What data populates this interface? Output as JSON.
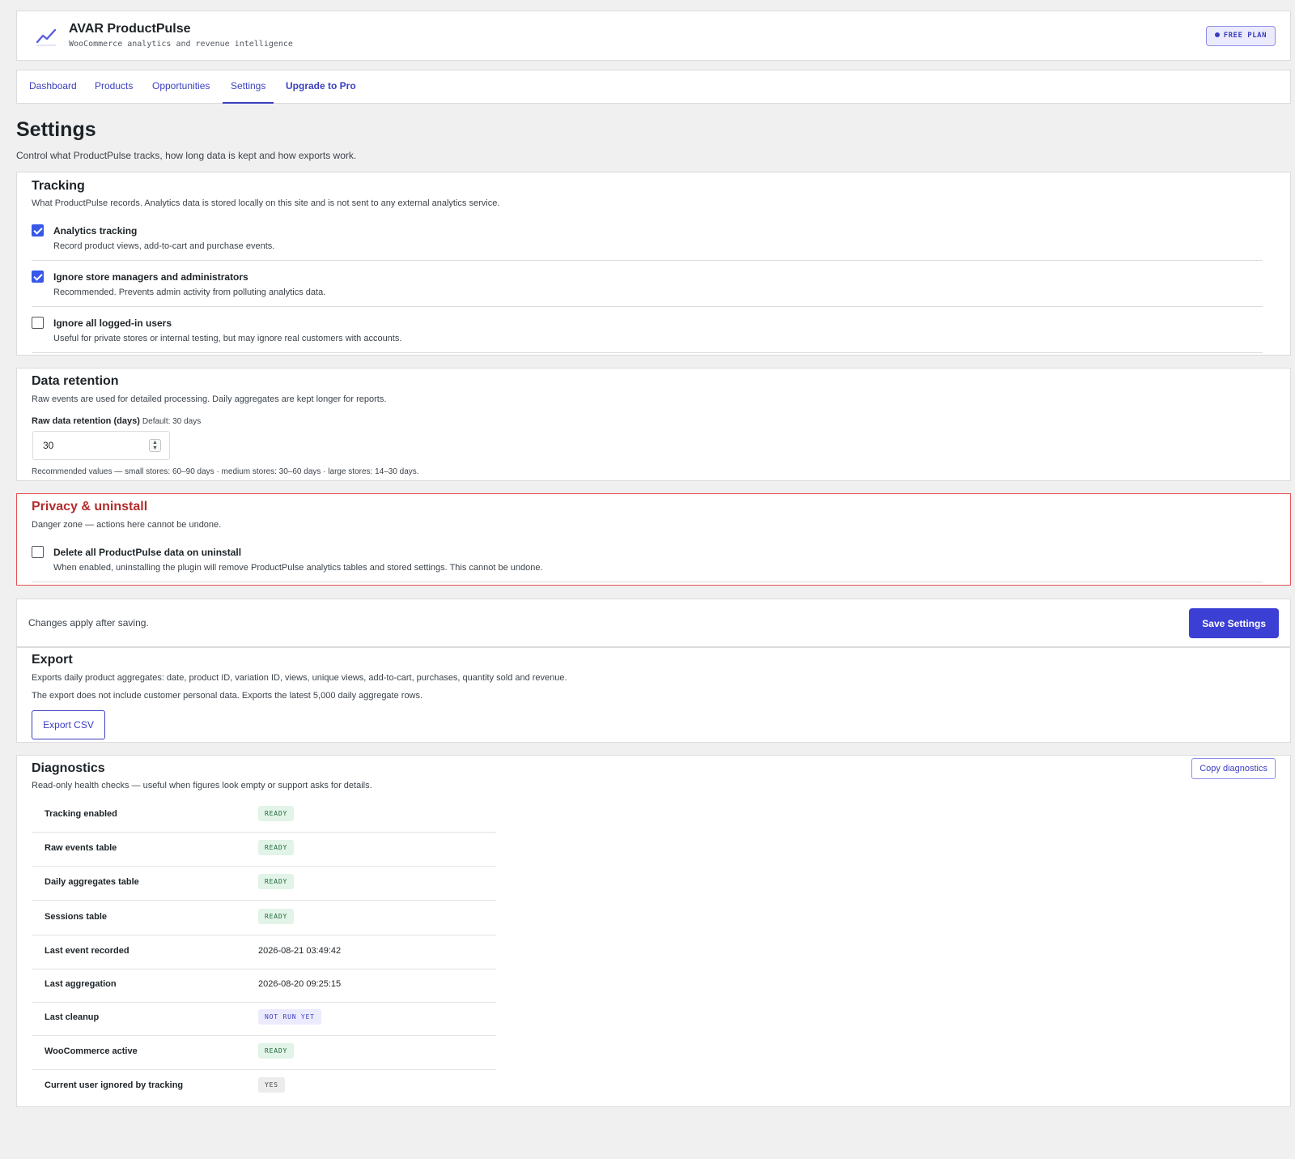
{
  "header": {
    "title": "AVAR ProductPulse",
    "subtitle": "WooCommerce analytics and revenue intelligence",
    "plan_badge": "FREE PLAN",
    "logo_icon": "trend-line-icon"
  },
  "tabs": [
    {
      "label": "Dashboard",
      "active": false
    },
    {
      "label": "Products",
      "active": false
    },
    {
      "label": "Opportunities",
      "active": false
    },
    {
      "label": "Settings",
      "active": true
    },
    {
      "label": "Upgrade to Pro",
      "active": false
    }
  ],
  "page": {
    "title": "Settings",
    "description": "Control what ProductPulse tracks, how long data is kept and how exports work."
  },
  "tracking": {
    "title": "Tracking",
    "description": "What ProductPulse records. Analytics data is stored locally on this site and is not sent to any external analytics service.",
    "options": [
      {
        "label": "Analytics tracking",
        "hint": "Record product views, add-to-cart and purchase events.",
        "checked": true
      },
      {
        "label": "Ignore store managers and administrators",
        "hint": "Recommended. Prevents admin activity from polluting analytics data.",
        "checked": true
      },
      {
        "label": "Ignore all logged-in users",
        "hint": "Useful for private stores or internal testing, but may ignore real customers with accounts.",
        "checked": false
      }
    ]
  },
  "retention": {
    "title": "Data retention",
    "description": "Raw events are used for detailed processing. Daily aggregates are kept longer for reports.",
    "field_label": "Raw data retention (days)",
    "field_default": "Default: 30 days",
    "field_value": "30",
    "recommendation": "Recommended values — small stores: 60–90 days · medium stores: 30–60 days · large stores: 14–30 days."
  },
  "privacy": {
    "title": "Privacy & uninstall",
    "description": "Danger zone — actions here cannot be undone.",
    "option_label": "Delete all ProductPulse data on uninstall",
    "option_hint": "When enabled, uninstalling the plugin will remove ProductPulse analytics tables and stored settings. This cannot be undone.",
    "checked": false
  },
  "savebar": {
    "text": "Changes apply after saving.",
    "button": "Save Settings"
  },
  "export": {
    "title": "Export",
    "line1": "Exports daily product aggregates: date, product ID, variation ID, views, unique views, add-to-cart, purchases, quantity sold and revenue.",
    "line2": "The export does not include customer personal data. Exports the latest 5,000 daily aggregate rows.",
    "button": "Export CSV"
  },
  "diagnostics": {
    "title": "Diagnostics",
    "description": "Read-only health checks — useful when figures look empty or support asks for details.",
    "copy_button": "Copy diagnostics",
    "rows": [
      {
        "key": "Tracking enabled",
        "value": "READY",
        "type": "ready"
      },
      {
        "key": "Raw events table",
        "value": "READY",
        "type": "ready"
      },
      {
        "key": "Daily aggregates table",
        "value": "READY",
        "type": "ready"
      },
      {
        "key": "Sessions table",
        "value": "READY",
        "type": "ready"
      },
      {
        "key": "Last event recorded",
        "value": "2026-08-21 03:49:42",
        "type": "text"
      },
      {
        "key": "Last aggregation",
        "value": "2026-08-20 09:25:15",
        "type": "text"
      },
      {
        "key": "Last cleanup",
        "value": "NOT RUN YET",
        "type": "notrun"
      },
      {
        "key": "WooCommerce active",
        "value": "READY",
        "type": "ready"
      },
      {
        "key": "Current user ignored by tracking",
        "value": "YES",
        "type": "yes"
      }
    ]
  },
  "colors": {
    "accent": "#3b3fbf",
    "primary_button": "#3b3fd3",
    "checkbox": "#3858e9",
    "danger": "#b32d2e",
    "ready_bg": "#e2f3e8"
  }
}
